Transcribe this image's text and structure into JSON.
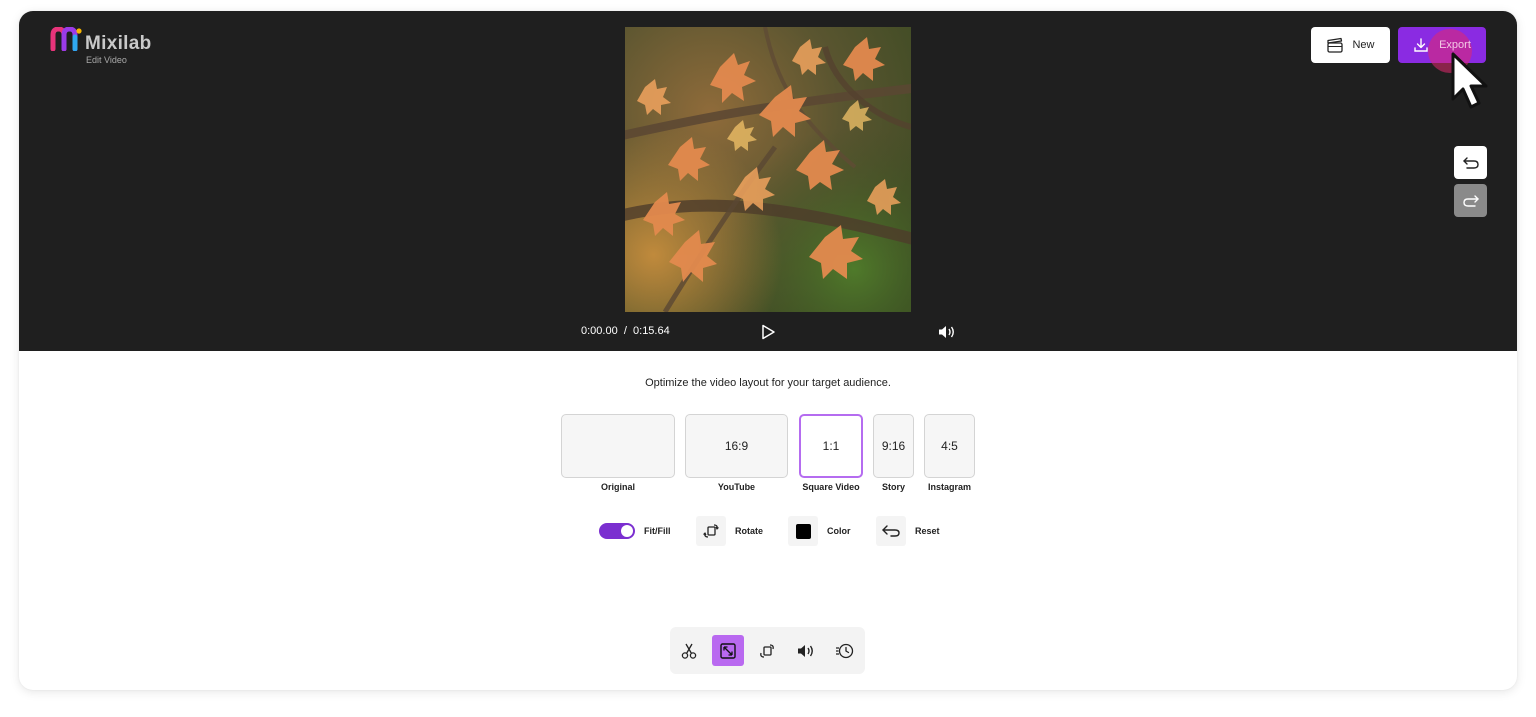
{
  "brand": {
    "name": "Mixilab",
    "subtitle": "Edit Video",
    "accent": "#8a2be2"
  },
  "header": {
    "new_label": "New",
    "export_label": "Export"
  },
  "player": {
    "current_time": "0:00.00",
    "separator": "/",
    "duration": "0:15.64"
  },
  "panel": {
    "instruction": "Optimize the video layout for your target audience.",
    "ratios": [
      {
        "value": "",
        "label": "Original",
        "selected": false
      },
      {
        "value": "16:9",
        "label": "YouTube",
        "selected": false
      },
      {
        "value": "1:1",
        "label": "Square Video",
        "selected": true
      },
      {
        "value": "9:16",
        "label": "Story",
        "selected": false
      },
      {
        "value": "4:5",
        "label": "Instagram",
        "selected": false
      }
    ],
    "controls": {
      "fit_fill": "Fit/Fill",
      "rotate": "Rotate",
      "color": "Color",
      "reset": "Reset"
    },
    "selected_color": "#000000",
    "fit_fill_on": true
  },
  "toolbar": {
    "tools": [
      {
        "icon": "scissors-icon",
        "active": false
      },
      {
        "icon": "resize-icon",
        "active": true
      },
      {
        "icon": "rotate-icon",
        "active": false
      },
      {
        "icon": "volume-icon",
        "active": false
      },
      {
        "icon": "speed-icon",
        "active": false
      }
    ]
  }
}
